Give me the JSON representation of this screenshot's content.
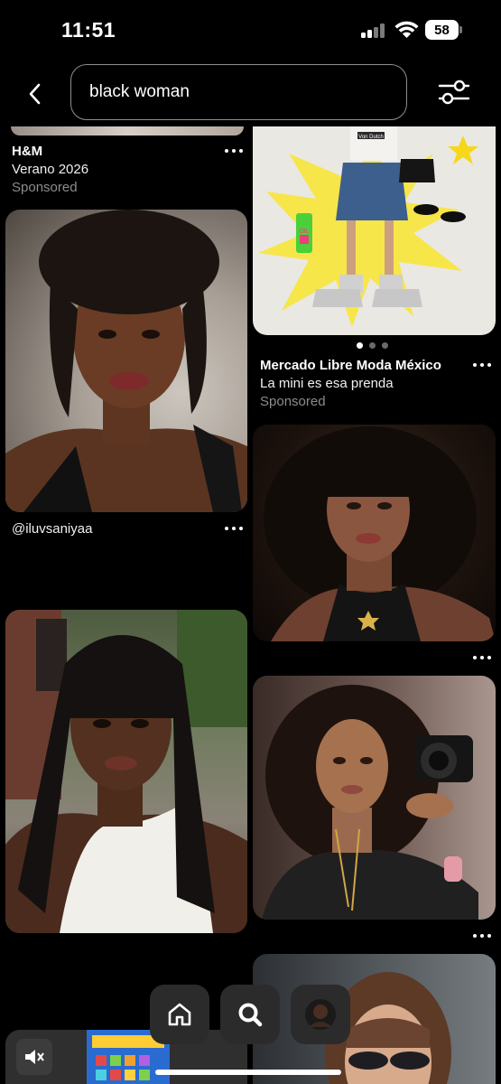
{
  "status_bar": {
    "time": "11:51",
    "battery": "58"
  },
  "search": {
    "query": "black woman"
  },
  "pins": {
    "hm": {
      "title": "H&M",
      "subtitle": "Verano 2026",
      "sponsored": "Sponsored"
    },
    "mercado": {
      "title": "Mercado Libre Moda México",
      "subtitle": "La mini es esa prenda",
      "sponsored": "Sponsored",
      "sticker_text": "Von Dutch",
      "gloss_text": "OIL",
      "carousel_pages": 3,
      "carousel_active": 1
    },
    "iluvsaniyaa": {
      "author": "@iluvsaniyaa"
    }
  },
  "colors": {
    "background": "#000000",
    "nav_button": "#2b2b2b",
    "muted_text": "#8c8c8c",
    "accent_yellow": "#f6e64a"
  },
  "bottom_nav": {
    "items": [
      "home-icon",
      "search-icon",
      "profile-avatar"
    ],
    "active": "search-icon"
  }
}
